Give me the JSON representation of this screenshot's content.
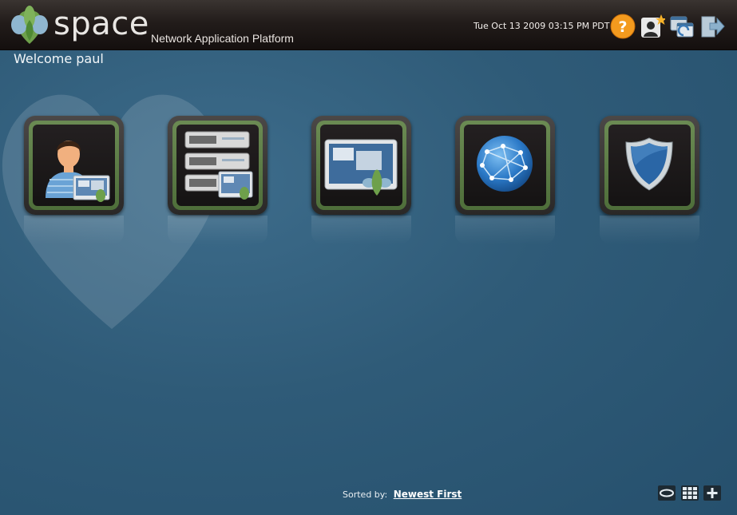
{
  "header": {
    "logo_text": "SPACE",
    "tagline": "Network Application Platform",
    "datetime": "Tue Oct 13 2009 03:15 PM PDT",
    "icons": [
      "help-icon",
      "user-favorites-icon",
      "switch-window-icon",
      "logout-icon"
    ]
  },
  "welcome": "Welcome paul",
  "apps": [
    {
      "icon": "user-admin-icon"
    },
    {
      "icon": "device-servers-icon"
    },
    {
      "icon": "platform-window-icon"
    },
    {
      "icon": "network-globe-icon"
    },
    {
      "icon": "security-shield-icon"
    }
  ],
  "footer": {
    "sorted_label": "Sorted by:",
    "sorted_value": "Newest First",
    "view_icons": [
      "carousel-view-icon",
      "grid-view-icon",
      "add-icon"
    ]
  },
  "colors": {
    "header_bg": "#1c1614",
    "body_bg": "#2f5b78",
    "tile_border": "#5e7e46",
    "help_orange": "#f39a1e"
  }
}
